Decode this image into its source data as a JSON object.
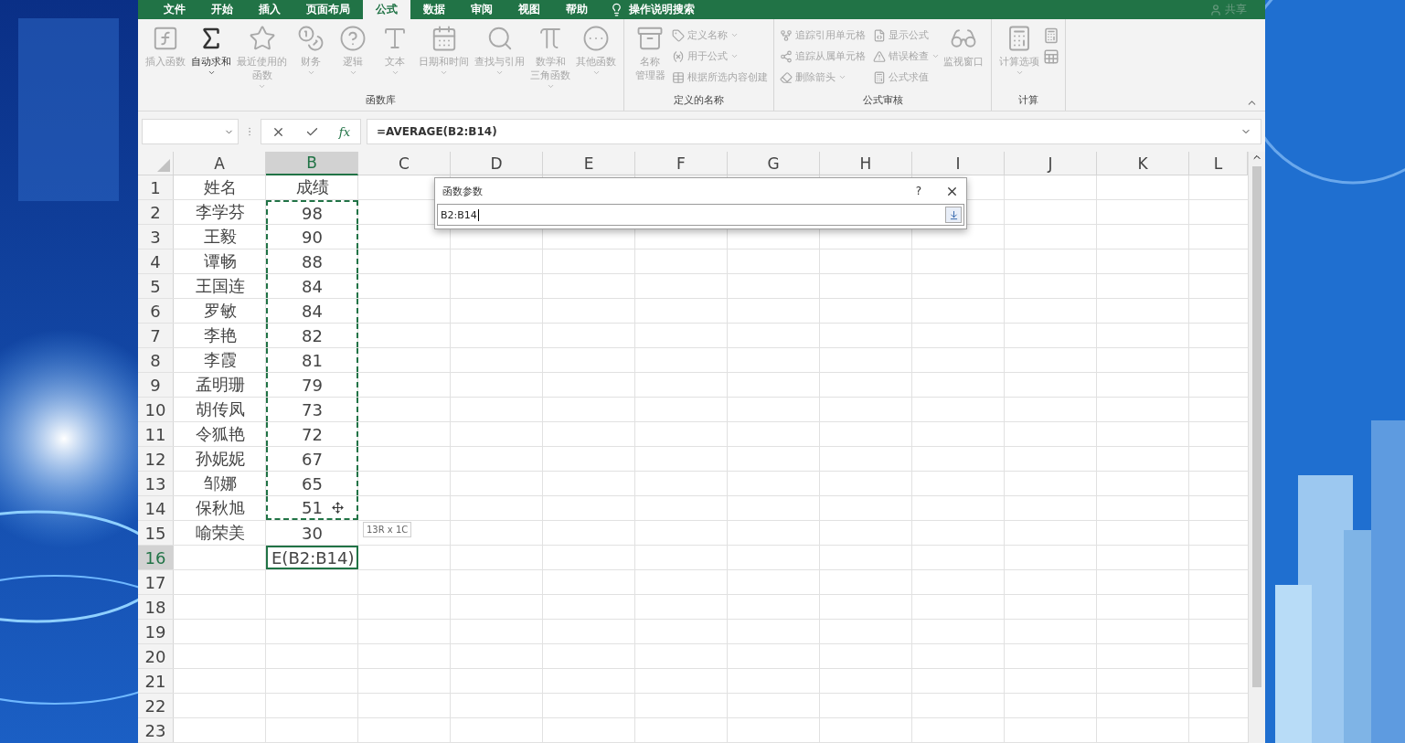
{
  "tabs": [
    {
      "label": "文件",
      "selected": false
    },
    {
      "label": "开始",
      "selected": false
    },
    {
      "label": "插入",
      "selected": false
    },
    {
      "label": "页面布局",
      "selected": false
    },
    {
      "label": "公式",
      "selected": true
    },
    {
      "label": "数据",
      "selected": false
    },
    {
      "label": "审阅",
      "selected": false
    },
    {
      "label": "视图",
      "selected": false
    },
    {
      "label": "帮助",
      "selected": false
    }
  ],
  "tell_me": "操作说明搜索",
  "share": "共享",
  "ribbon": {
    "groups": [
      {
        "label": "函数库",
        "items": [
          {
            "kind": "large",
            "label": "插入函数",
            "disabled": true,
            "dropdown": false
          },
          {
            "kind": "large",
            "label": "自动求和",
            "disabled": false,
            "dropdown": true
          },
          {
            "kind": "large",
            "label": [
              "最近使用的",
              "函数"
            ],
            "disabled": true,
            "dropdown": true
          },
          {
            "kind": "large",
            "label": "财务",
            "disabled": true,
            "dropdown": true
          },
          {
            "kind": "large",
            "label": "逻辑",
            "disabled": true,
            "dropdown": true
          },
          {
            "kind": "large",
            "label": "文本",
            "disabled": true,
            "dropdown": true
          },
          {
            "kind": "large",
            "label": "日期和时间",
            "disabled": true,
            "dropdown": true
          },
          {
            "kind": "large",
            "label": "查找与引用",
            "disabled": true,
            "dropdown": true
          },
          {
            "kind": "large",
            "label": [
              "数学和",
              "三角函数"
            ],
            "disabled": true,
            "dropdown": true
          },
          {
            "kind": "large",
            "label": "其他函数",
            "disabled": true,
            "dropdown": true
          }
        ]
      },
      {
        "label": "定义的名称",
        "items": [
          {
            "kind": "large",
            "label": [
              "名称",
              "管理器"
            ],
            "disabled": true,
            "dropdown": false
          },
          {
            "kind": "small",
            "label": "定义名称",
            "disabled": true,
            "dropdown": true
          },
          {
            "kind": "small",
            "label": "用于公式",
            "disabled": true,
            "dropdown": true
          },
          {
            "kind": "small",
            "label": "根据所选内容创建",
            "disabled": true,
            "dropdown": false
          }
        ]
      },
      {
        "label": "公式审核",
        "items": [
          {
            "kind": "small",
            "label": "追踪引用单元格",
            "disabled": true,
            "dropdown": false
          },
          {
            "kind": "small",
            "label": "追踪从属单元格",
            "disabled": true,
            "dropdown": false
          },
          {
            "kind": "small",
            "label": "删除箭头",
            "disabled": true,
            "dropdown": true
          },
          {
            "kind": "small",
            "label": "显示公式",
            "disabled": true,
            "dropdown": false
          },
          {
            "kind": "small",
            "label": "错误检查",
            "disabled": true,
            "dropdown": true
          },
          {
            "kind": "small",
            "label": "公式求值",
            "disabled": true,
            "dropdown": false
          },
          {
            "kind": "large",
            "label": "监视窗口",
            "disabled": true,
            "dropdown": false
          }
        ]
      },
      {
        "label": "计算",
        "items": [
          {
            "kind": "large",
            "label": "计算选项",
            "disabled": true,
            "dropdown": true
          },
          {
            "kind": "icon",
            "disabled": true,
            "dropdown": false
          },
          {
            "kind": "icon",
            "disabled": true,
            "dropdown": false
          }
        ]
      }
    ]
  },
  "formula_bar": {
    "fx": "fx",
    "formula": "=AVERAGE(B2:B14)"
  },
  "sheet": {
    "columns": [
      {
        "label": "A",
        "selected": false
      },
      {
        "label": "B",
        "selected": true
      },
      {
        "label": "C",
        "selected": false
      },
      {
        "label": "D",
        "selected": false
      },
      {
        "label": "E",
        "selected": false
      },
      {
        "label": "F",
        "selected": false
      },
      {
        "label": "G",
        "selected": false
      },
      {
        "label": "H",
        "selected": false
      },
      {
        "label": "I",
        "selected": false
      },
      {
        "label": "J",
        "selected": false
      },
      {
        "label": "K",
        "selected": false
      },
      {
        "label": "L",
        "selected": false
      }
    ],
    "rows": [
      {
        "number": "1",
        "selected": false,
        "in_range": false,
        "name": "姓名",
        "score": "成绩"
      },
      {
        "number": "2",
        "selected": false,
        "in_range": true,
        "name": "李学芬",
        "score": "98"
      },
      {
        "number": "3",
        "selected": false,
        "in_range": true,
        "name": "王毅",
        "score": "90"
      },
      {
        "number": "4",
        "selected": false,
        "in_range": true,
        "name": "谭畅",
        "score": "88"
      },
      {
        "number": "5",
        "selected": false,
        "in_range": true,
        "name": "王国连",
        "score": "84"
      },
      {
        "number": "6",
        "selected": false,
        "in_range": true,
        "name": "罗敏",
        "score": "84"
      },
      {
        "number": "7",
        "selected": false,
        "in_range": true,
        "name": "李艳",
        "score": "82"
      },
      {
        "number": "8",
        "selected": false,
        "in_range": true,
        "name": "李霞",
        "score": "81"
      },
      {
        "number": "9",
        "selected": false,
        "in_range": true,
        "name": "孟明珊",
        "score": "79"
      },
      {
        "number": "10",
        "selected": false,
        "in_range": true,
        "name": "胡传凤",
        "score": "73"
      },
      {
        "number": "11",
        "selected": false,
        "in_range": true,
        "name": "令狐艳",
        "score": "72"
      },
      {
        "number": "12",
        "selected": false,
        "in_range": true,
        "name": "孙妮妮",
        "score": "67"
      },
      {
        "number": "13",
        "selected": false,
        "in_range": true,
        "name": "邹娜",
        "score": "65"
      },
      {
        "number": "14",
        "selected": false,
        "in_range": true,
        "name": "保秋旭",
        "score": "51"
      },
      {
        "number": "15",
        "selected": false,
        "in_range": false,
        "name": "喻荣美",
        "score": "30"
      },
      {
        "number": "16",
        "selected": true,
        "in_range": false,
        "score": "E(B2:B14)"
      },
      {
        "number": "17",
        "selected": false,
        "in_range": false
      },
      {
        "number": "18",
        "selected": false,
        "in_range": false
      },
      {
        "number": "19",
        "selected": false,
        "in_range": false
      },
      {
        "number": "20",
        "selected": false,
        "in_range": false
      },
      {
        "number": "21",
        "selected": false,
        "in_range": false
      },
      {
        "number": "22",
        "selected": false,
        "in_range": false
      },
      {
        "number": "23",
        "selected": false,
        "in_range": false
      }
    ],
    "range_tooltip": "13R x 1C"
  },
  "dialog": {
    "title": "函数参数",
    "help": "?",
    "value": "B2:B14"
  }
}
